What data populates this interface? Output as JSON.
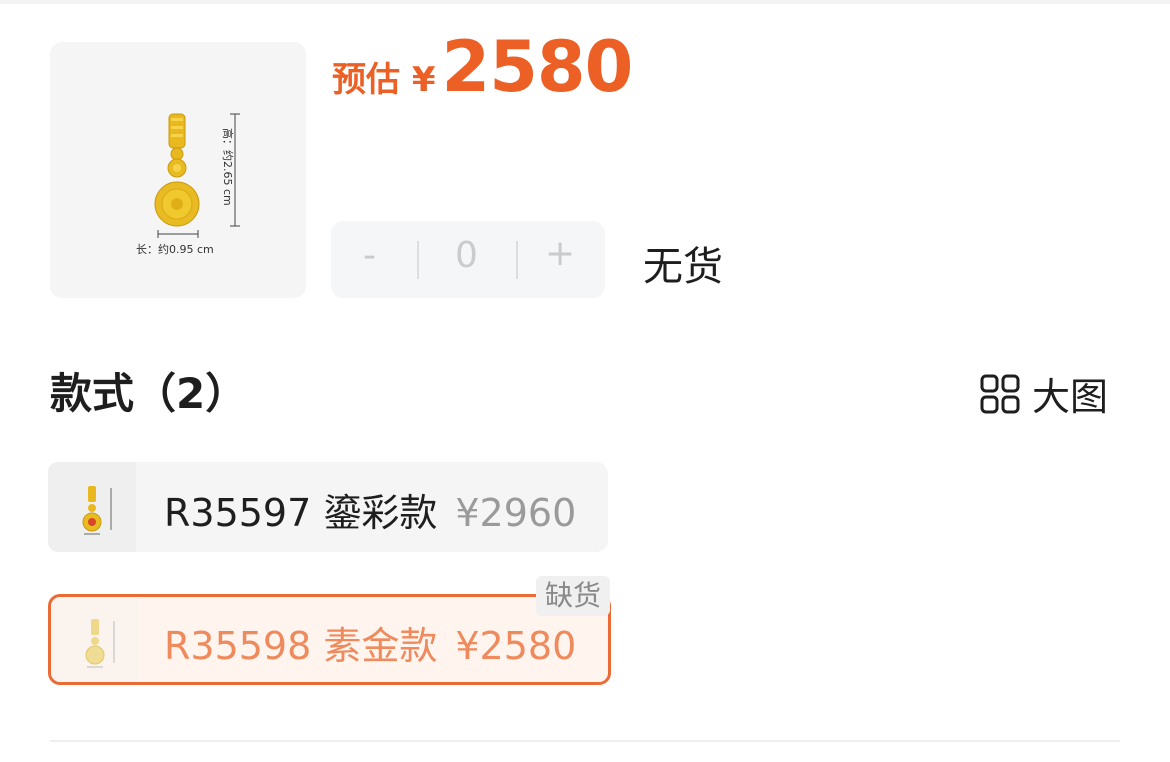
{
  "product": {
    "image_icon": "gold-pendant-image",
    "dimension_height": "高：约2.65 cm",
    "dimension_width": "长：约0.95 cm"
  },
  "price": {
    "prefix": "预估 ¥",
    "value": "2580"
  },
  "stepper": {
    "minus": "-",
    "quantity": "0",
    "plus": "+"
  },
  "stock_status": "无货",
  "styles_section": {
    "title": "款式（2）",
    "big_view_label": "大图",
    "big_view_icon": "grid-icon"
  },
  "variants": [
    {
      "code_name": "R35597 鎏彩款",
      "price": "¥2960",
      "selected": false
    },
    {
      "code_name": "R35598 素金款",
      "price": "¥2580",
      "selected": true,
      "badge": "缺货"
    }
  ],
  "colors": {
    "accent": "#ec6026",
    "selected_border": "#ea6b35",
    "selected_text": "#ef8a5c"
  }
}
